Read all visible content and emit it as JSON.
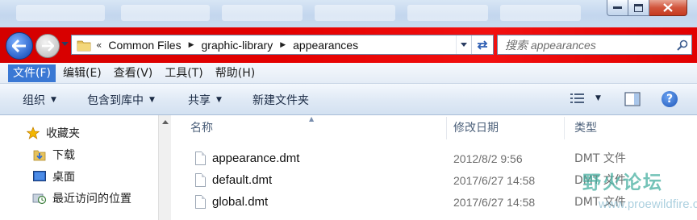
{
  "window": {
    "controls": {
      "minimize_icon": "minimize-icon",
      "maximize_icon": "maximize-icon",
      "close_icon": "close-icon"
    }
  },
  "address_bar": {
    "overflow": "«",
    "path": [
      "Common Files",
      "graphic-library",
      "appearances"
    ]
  },
  "search": {
    "placeholder": "搜索 appearances"
  },
  "menu": {
    "items": [
      "文件(F)",
      "编辑(E)",
      "查看(V)",
      "工具(T)",
      "帮助(H)"
    ],
    "active_index": 0
  },
  "toolbar": {
    "organize": "组织",
    "include_in_library": "包含到库中",
    "share": "共享",
    "new_folder": "新建文件夹",
    "help": "?"
  },
  "nav_pane": {
    "items": [
      {
        "label": "收藏夹",
        "icon": "star-icon"
      },
      {
        "label": "下载",
        "icon": "download-folder-icon"
      },
      {
        "label": "桌面",
        "icon": "desktop-icon"
      },
      {
        "label": "最近访问的位置",
        "icon": "recent-places-icon"
      }
    ]
  },
  "file_list": {
    "columns": [
      "名称",
      "修改日期",
      "类型"
    ],
    "files": [
      {
        "name": "appearance.dmt",
        "modified": "2012/8/2 9:56",
        "type": "DMT 文件"
      },
      {
        "name": "default.dmt",
        "modified": "2017/6/27 14:58",
        "type": "DMT 文件"
      },
      {
        "name": "global.dmt",
        "modified": "2017/6/27 14:58",
        "type": "DMT 文件"
      }
    ]
  },
  "watermark": {
    "title": "野火论坛",
    "url": "www.proewildfire.cn"
  },
  "colors": {
    "accent_red": "#e40000",
    "menu_highlight": "#3a78d4",
    "header_text": "#4c607a",
    "secondary_text": "#6d6d6d"
  }
}
